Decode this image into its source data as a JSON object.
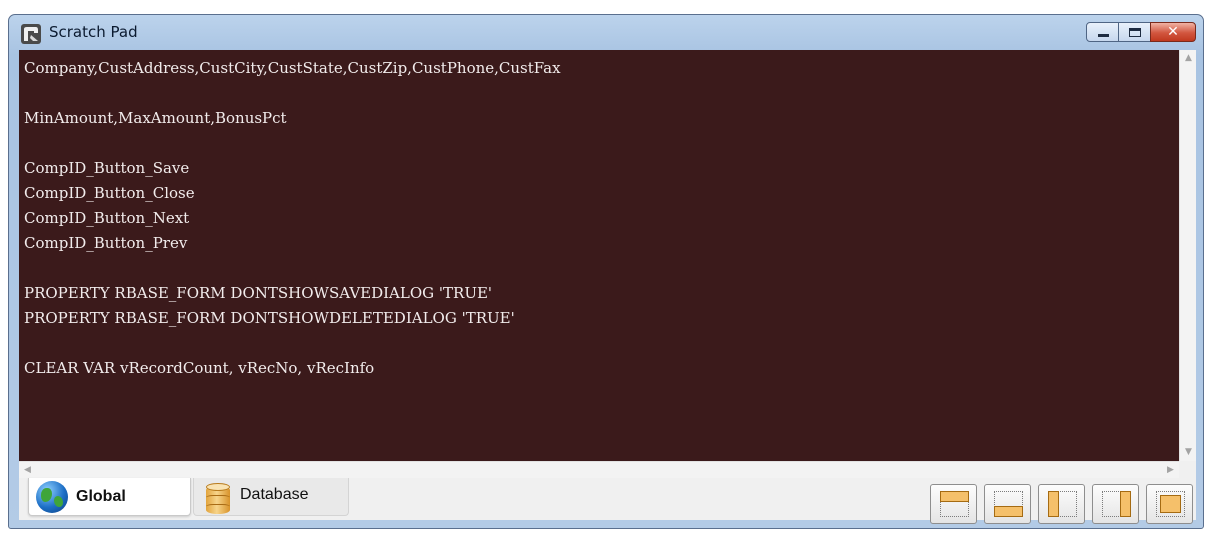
{
  "window": {
    "title": "Scratch Pad",
    "icon": "app-icon",
    "caption_buttons": [
      "minimize",
      "maximize",
      "close"
    ],
    "close_glyph": "✕"
  },
  "editor": {
    "background": "#3b1a1b",
    "text_color": "#f2ecec",
    "lines": [
      "Company,CustAddress,CustCity,CustState,CustZip,CustPhone,CustFax",
      "",
      "MinAmount,MaxAmount,BonusPct",
      "",
      "CompID_Button_Save",
      "CompID_Button_Close",
      "CompID_Button_Next",
      "CompID_Button_Prev",
      "",
      "PROPERTY RBASE_FORM DONTSHOWSAVEDIALOG 'TRUE'",
      "PROPERTY RBASE_FORM DONTSHOWDELETEDIALOG 'TRUE'",
      "",
      "CLEAR VAR vRecordCount, vRecNo, vRecInfo"
    ]
  },
  "scrollbars": {
    "up_glyph": "▲",
    "down_glyph": "▼",
    "left_glyph": "◀",
    "right_glyph": "▶"
  },
  "tabs": [
    {
      "label": "Global",
      "icon": "globe-icon",
      "active": true
    },
    {
      "label": "Database",
      "icon": "database-icon",
      "active": false
    }
  ],
  "layout_buttons": [
    "dock-top",
    "dock-bottom",
    "dock-left",
    "dock-right",
    "dock-fill"
  ],
  "colors": {
    "accent_fill": "#f5c06a",
    "close_button": "#c0391f"
  }
}
